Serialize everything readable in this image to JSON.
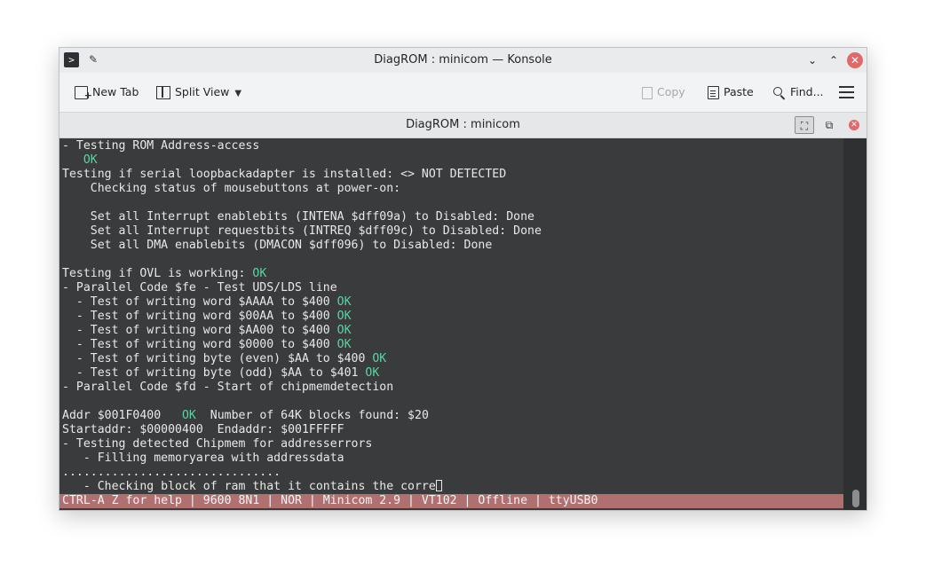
{
  "window": {
    "title": "DiagROM : minicom — Konsole",
    "controls": {
      "minimize": "⌄",
      "maximize": "⌃",
      "close": "✕"
    }
  },
  "toolbar": {
    "new_tab": "New Tab",
    "split_view": "Split View",
    "copy": "Copy",
    "paste": "Paste",
    "find": "Find..."
  },
  "tab": {
    "title": "DiagROM : minicom"
  },
  "terminal": {
    "lines": [
      [
        {
          "t": "- Testing ROM Address-access"
        }
      ],
      [
        {
          "t": "   "
        },
        {
          "t": "OK",
          "ok": true
        }
      ],
      [
        {
          "t": "Testing if serial loopbackadapter is installed: <> NOT DETECTED"
        }
      ],
      [
        {
          "t": "    Checking status of mousebuttons at power-on:"
        }
      ],
      [
        {
          "t": ""
        }
      ],
      [
        {
          "t": "    Set all Interrupt enablebits (INTENA $dff09a) to Disabled: Done"
        }
      ],
      [
        {
          "t": "    Set all Interrupt requestbits (INTREQ $dff09c) to Disabled: Done"
        }
      ],
      [
        {
          "t": "    Set all DMA enablebits (DMACON $dff096) to Disabled: Done"
        }
      ],
      [
        {
          "t": ""
        }
      ],
      [
        {
          "t": "Testing if OVL is working: "
        },
        {
          "t": "OK",
          "ok": true
        }
      ],
      [
        {
          "t": "- Parallel Code $fe - Test UDS/LDS line"
        }
      ],
      [
        {
          "t": "  - Test of writing word $AAAA to $400 "
        },
        {
          "t": "OK",
          "ok": true
        }
      ],
      [
        {
          "t": "  - Test of writing word $00AA to $400 "
        },
        {
          "t": "OK",
          "ok": true
        }
      ],
      [
        {
          "t": "  - Test of writing word $AA00 to $400 "
        },
        {
          "t": "OK",
          "ok": true
        }
      ],
      [
        {
          "t": "  - Test of writing word $0000 to $400 "
        },
        {
          "t": "OK",
          "ok": true
        }
      ],
      [
        {
          "t": "  - Test of writing byte (even) $AA to $400 "
        },
        {
          "t": "OK",
          "ok": true
        }
      ],
      [
        {
          "t": "  - Test of writing byte (odd) $AA to $401 "
        },
        {
          "t": "OK",
          "ok": true
        }
      ],
      [
        {
          "t": "- Parallel Code $fd - Start of chipmemdetection"
        }
      ],
      [
        {
          "t": ""
        }
      ],
      [
        {
          "t": "Addr $001F0400   "
        },
        {
          "t": "OK",
          "ok": true
        },
        {
          "t": "  Number of 64K blocks found: $20"
        }
      ],
      [
        {
          "t": "Startaddr: $00000400  Endaddr: $001FFFFF"
        }
      ],
      [
        {
          "t": "- Testing detected Chipmem for addresserrors"
        }
      ],
      [
        {
          "t": "   - Filling memoryarea with addressdata"
        }
      ],
      [
        {
          "t": "..............................."
        }
      ],
      [
        {
          "t": "   - Checking block of ram that it contains the corre"
        },
        {
          "cursor": true
        }
      ]
    ],
    "status_bar": "CTRL-A Z for help | 9600 8N1 | NOR | Minicom 2.9 | VT102 | Offline | ttyUSB0"
  }
}
